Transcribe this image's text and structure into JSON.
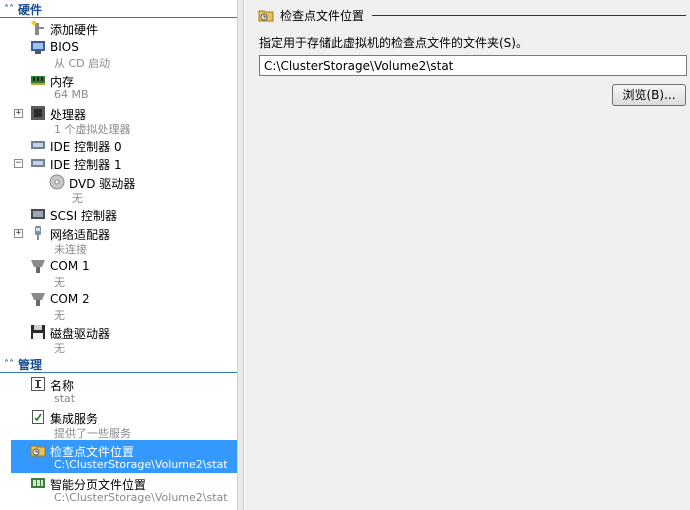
{
  "sidebar": {
    "hardware_header": "硬件",
    "management_header": "管理",
    "hardware": [
      {
        "title": "添加硬件",
        "icon": "add-hardware-icon"
      },
      {
        "title": "BIOS",
        "subtitle": "从 CD 启动",
        "icon": "bios-icon"
      },
      {
        "title": "内存",
        "subtitle": "64 MB",
        "icon": "memory-icon"
      },
      {
        "title": "处理器",
        "subtitle": "1 个虚拟处理器",
        "icon": "processor-icon",
        "expander": "+"
      },
      {
        "title": "IDE 控制器 0",
        "icon": "ide-controller-icon"
      },
      {
        "title": "IDE 控制器 1",
        "icon": "ide-controller-icon",
        "expander": "−"
      },
      {
        "title": "DVD 驱动器",
        "subtitle": "无",
        "icon": "dvd-drive-icon"
      },
      {
        "title": "SCSI 控制器",
        "icon": "scsi-controller-icon"
      },
      {
        "title": "网络适配器",
        "subtitle": "未连接",
        "icon": "network-adapter-icon",
        "expander": "+"
      },
      {
        "title": "COM 1",
        "subtitle": "无",
        "icon": "com-port-icon"
      },
      {
        "title": "COM 2",
        "subtitle": "无",
        "icon": "com-port-icon"
      },
      {
        "title": "磁盘驱动器",
        "subtitle": "无",
        "icon": "floppy-drive-icon"
      }
    ],
    "management": [
      {
        "title": "名称",
        "subtitle": "stat",
        "icon": "name-icon"
      },
      {
        "title": "集成服务",
        "subtitle": "提供了一些服务",
        "icon": "integration-services-icon"
      },
      {
        "title": "检查点文件位置",
        "subtitle": "C:\\ClusterStorage\\Volume2\\stat",
        "icon": "checkpoint-location-icon",
        "selected": true
      },
      {
        "title": "智能分页文件位置",
        "subtitle": "C:\\ClusterStorage\\Volume2\\stat",
        "icon": "smart-paging-icon"
      }
    ]
  },
  "panel": {
    "title": "检查点文件位置",
    "description": "指定用于存储此虚拟机的检查点文件的文件夹(S)。",
    "path_value": "C:\\ClusterStorage\\Volume2\\stat",
    "browse_label": "浏览(B)..."
  },
  "colors": {
    "selection": "#3399ff",
    "section_header": "#1b4f8f",
    "panel_background": "#f0f0f0"
  }
}
